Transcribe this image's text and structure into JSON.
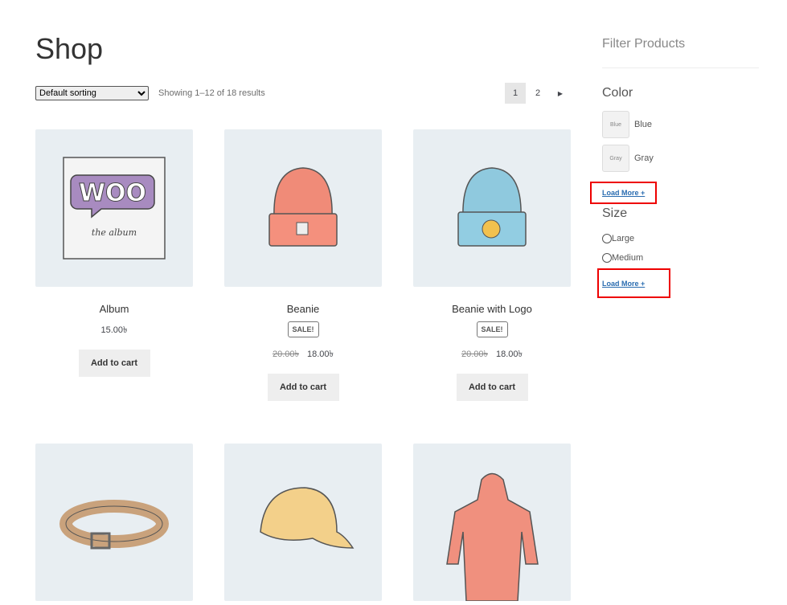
{
  "page_title": "Shop",
  "toolbar": {
    "sort_selected": "Default sorting",
    "result_count": "Showing 1–12 of 18 results",
    "pages": [
      "1",
      "2"
    ],
    "current_page": "1",
    "next_icon": "triangle-right-icon"
  },
  "products": [
    {
      "name": "Album",
      "price": "15.00৳",
      "button": "Add to cart",
      "image": "woo-album"
    },
    {
      "name": "Beanie",
      "badge": "SALE!",
      "old_price": "20.00৳",
      "price": "18.00৳",
      "button": "Add to cart",
      "image": "beanie"
    },
    {
      "name": "Beanie with Logo",
      "badge": "SALE!",
      "old_price": "20.00৳",
      "price": "18.00৳",
      "button": "Add to cart",
      "image": "beanie-logo"
    },
    {
      "image": "belt"
    },
    {
      "image": "cap"
    },
    {
      "image": "hoodie"
    }
  ],
  "album_art": {
    "logo": "WOO",
    "caption": "the album"
  },
  "sidebar": {
    "heading": "Filter Products",
    "color": {
      "title": "Color",
      "options": [
        {
          "swatch": "Blue",
          "label": "Blue"
        },
        {
          "swatch": "Gray",
          "label": "Gray"
        }
      ],
      "load_more": "Load More +"
    },
    "size": {
      "title": "Size",
      "options": [
        "Large",
        "Medium"
      ],
      "load_more": "Load More +"
    },
    "highlight_color": "#e00000"
  }
}
